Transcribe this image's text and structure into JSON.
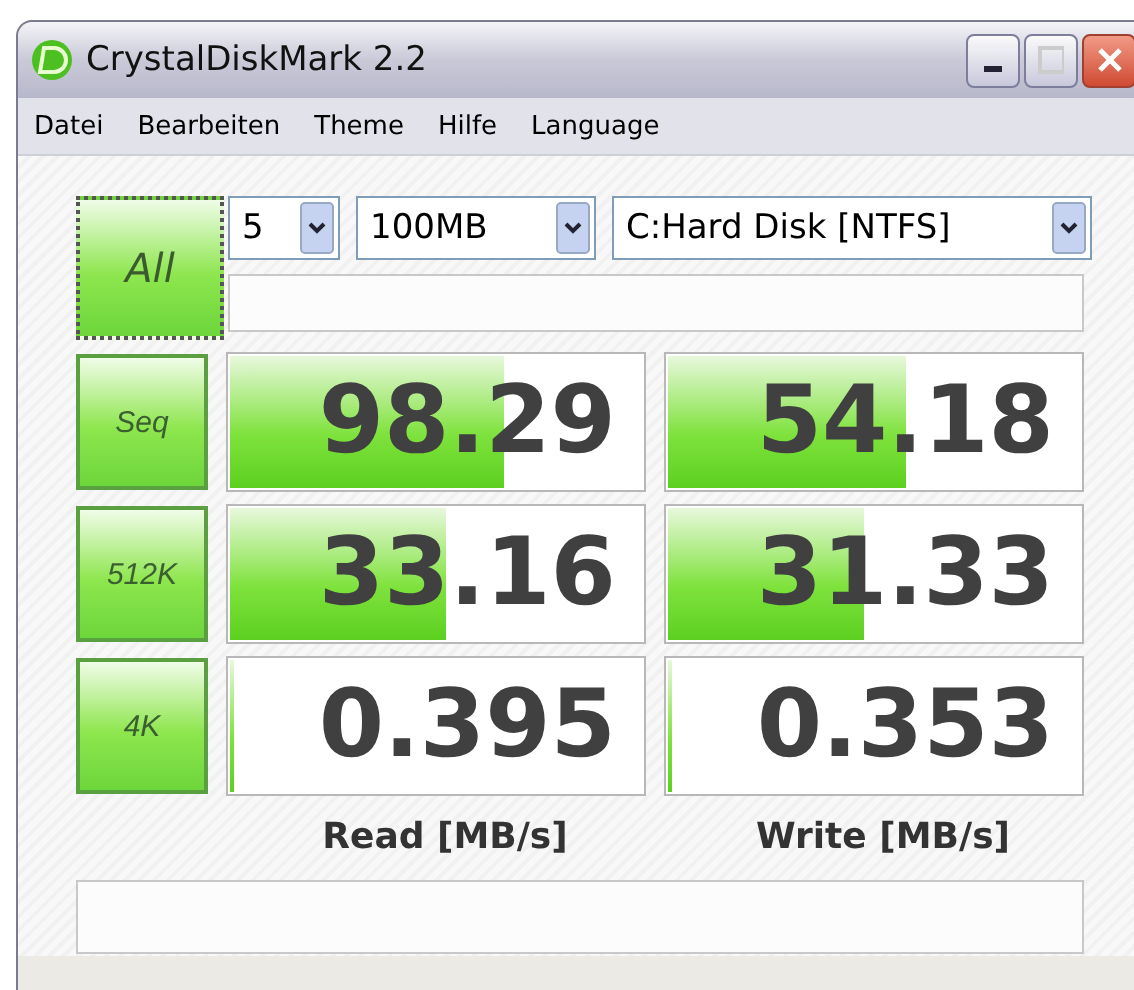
{
  "window": {
    "title": "CrystalDiskMark 2.2"
  },
  "menu": [
    "Datei",
    "Bearbeiten",
    "Theme",
    "Hilfe",
    "Language"
  ],
  "all_button": "All",
  "selectors": [
    {
      "value": "5"
    },
    {
      "value": "100MB"
    },
    {
      "value": "C:Hard Disk [NTFS]"
    }
  ],
  "tests": [
    {
      "label": "Seq",
      "read": {
        "value": "98.29",
        "level": 0.66
      },
      "write": {
        "value": "54.18",
        "level": 0.57
      }
    },
    {
      "label": "512K",
      "read": {
        "value": "33.16",
        "level": 0.52
      },
      "write": {
        "value": "31.33",
        "level": 0.47
      }
    },
    {
      "label": "4K",
      "read": {
        "value": "0.395",
        "level": 0
      },
      "write": {
        "value": "0.353",
        "level": 0
      }
    }
  ],
  "columns": [
    "Read [MB/s]",
    "Write [MB/s]"
  ]
}
